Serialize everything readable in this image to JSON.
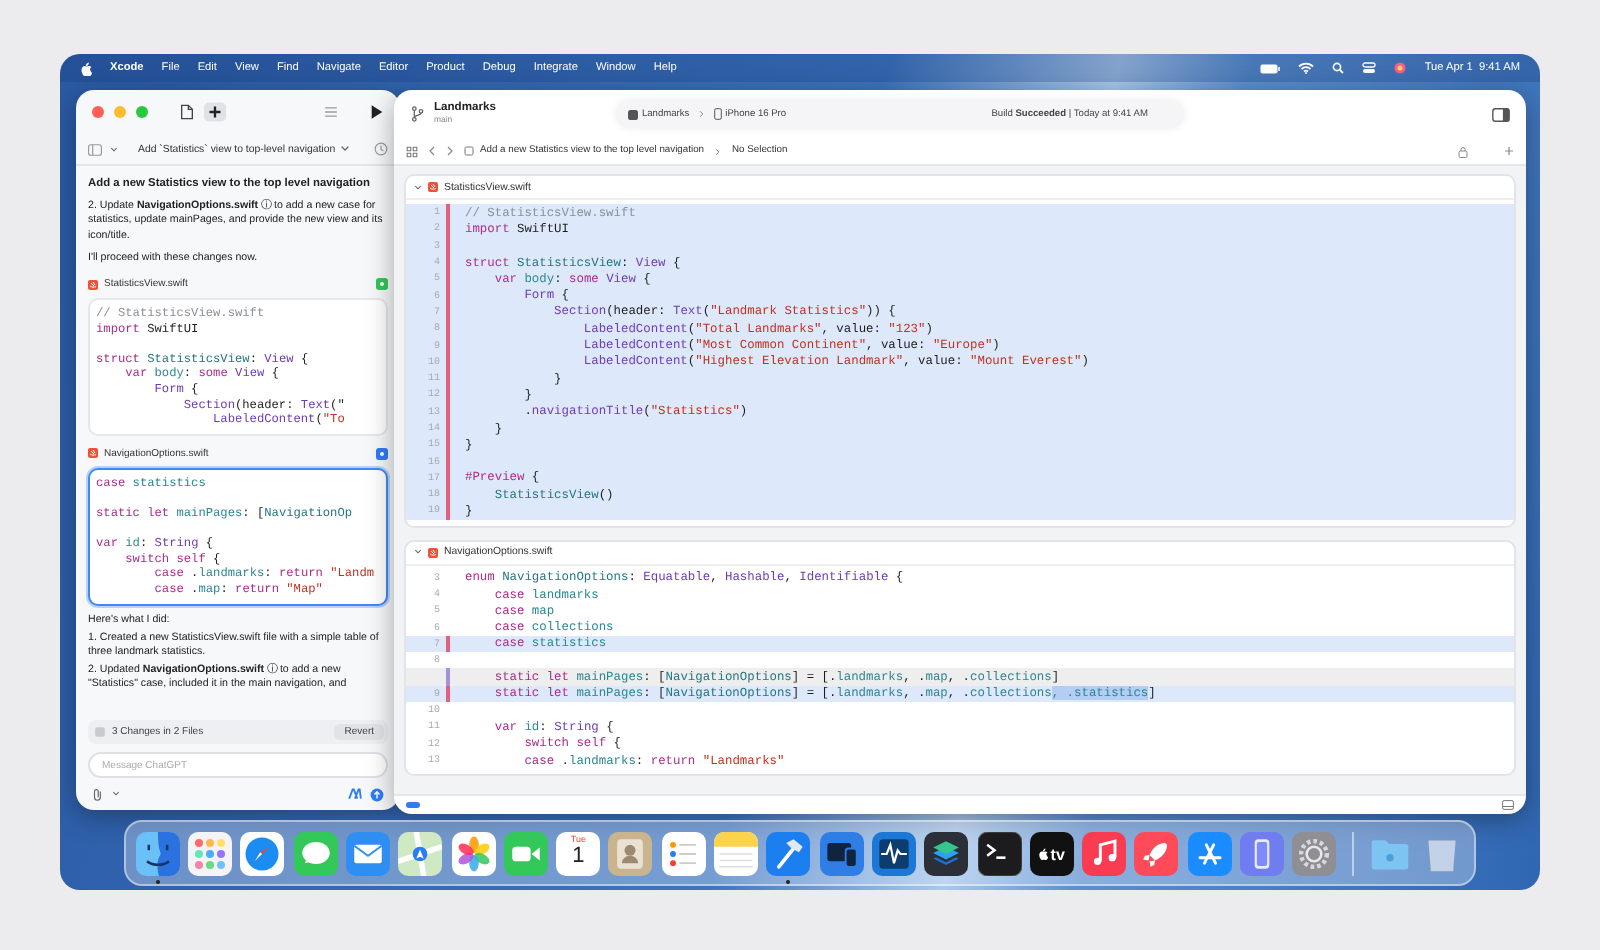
{
  "menu_bar": {
    "app": "Xcode",
    "items": [
      "File",
      "Edit",
      "View",
      "Find",
      "Navigate",
      "Editor",
      "Product",
      "Debug",
      "Integrate",
      "Window",
      "Help"
    ],
    "clock": "Tue Apr 1  9:41 AM"
  },
  "chat": {
    "title": "Add `Statistics` view to top-level navigation",
    "blocks": [
      {
        "kind": "heading",
        "text": "Add a new Statistics view to the top level navigation"
      },
      {
        "kind": "paragraph",
        "text": "2. Update **NavigationOptions.swift** ⓘ to add a new case for statistics, update mainPages, and provide the new view and its icon/title."
      },
      {
        "kind": "paragraph",
        "text": "I'll proceed with these changes now."
      },
      {
        "kind": "file",
        "name": "StatisticsView.swift",
        "color": "#34c759",
        "selected": false,
        "lines": [
          {
            "kind": "code",
            "tokens": [
              {
                "kind": "comment",
                "text": "// StatisticsView.swift"
              }
            ]
          },
          {
            "kind": "code",
            "tokens": [
              {
                "kind": "keyword",
                "text": "import"
              },
              {
                "kind": "plain",
                "text": " SwiftUI"
              }
            ]
          },
          {
            "kind": "blank"
          },
          {
            "kind": "code",
            "tokens": [
              {
                "kind": "keyword",
                "text": "struct "
              },
              {
                "kind": "type",
                "text": "StatisticsView"
              },
              {
                "kind": "plain",
                "text": ": "
              },
              {
                "kind": "class",
                "text": "View"
              },
              {
                "kind": "plain",
                "text": " {"
              }
            ]
          },
          {
            "kind": "code",
            "tokens": [
              {
                "kind": "keyword",
                "text": "    var "
              },
              {
                "kind": "member",
                "text": "body"
              },
              {
                "kind": "plain",
                "text": ": "
              },
              {
                "kind": "keyword",
                "text": "some "
              },
              {
                "kind": "class",
                "text": "View"
              },
              {
                "kind": "plain",
                "text": " {"
              }
            ]
          },
          {
            "kind": "code",
            "tokens": [
              {
                "kind": "class",
                "text": "        Form"
              },
              {
                "kind": "plain",
                "text": " {"
              }
            ]
          },
          {
            "kind": "code",
            "tokens": [
              {
                "kind": "class",
                "text": "            Section"
              },
              {
                "kind": "plain",
                "text": "(header: "
              },
              {
                "kind": "class",
                "text": "Text"
              },
              {
                "kind": "plain",
                "text": "(\""
              }
            ]
          },
          {
            "kind": "code",
            "tokens": [
              {
                "kind": "class",
                "text": "                LabeledContent"
              },
              {
                "kind": "plain",
                "text": "("
              },
              {
                "kind": "string",
                "text": "\"To"
              }
            ]
          }
        ]
      },
      {
        "kind": "file",
        "name": "NavigationOptions.swift",
        "color": "#2f7cf6",
        "selected": true,
        "lines": [
          {
            "kind": "code",
            "tokens": [
              {
                "kind": "keyword",
                "text": "case "
              },
              {
                "kind": "member",
                "text": "statistics"
              }
            ]
          },
          {
            "kind": "blank"
          },
          {
            "kind": "code",
            "tokens": [
              {
                "kind": "keyword",
                "text": "static let "
              },
              {
                "kind": "member",
                "text": "mainPages"
              },
              {
                "kind": "plain",
                "text": ": ["
              },
              {
                "kind": "type",
                "text": "NavigationOp"
              }
            ]
          },
          {
            "kind": "blank"
          },
          {
            "kind": "code",
            "tokens": [
              {
                "kind": "keyword",
                "text": "var "
              },
              {
                "kind": "member",
                "text": "id"
              },
              {
                "kind": "plain",
                "text": ": "
              },
              {
                "kind": "class",
                "text": "String"
              },
              {
                "kind": "plain",
                "text": " {"
              }
            ]
          },
          {
            "kind": "code",
            "tokens": [
              {
                "kind": "keyword",
                "text": "    switch self"
              },
              {
                "kind": "plain",
                "text": " {"
              }
            ]
          },
          {
            "kind": "code",
            "tokens": [
              {
                "kind": "keyword",
                "text": "        case"
              },
              {
                "kind": "plain",
                "text": " ."
              },
              {
                "kind": "member",
                "text": "landmarks"
              },
              {
                "kind": "plain",
                "text": ": "
              },
              {
                "kind": "keyword",
                "text": "return "
              },
              {
                "kind": "string",
                "text": "\"Landm"
              }
            ]
          },
          {
            "kind": "code",
            "tokens": [
              {
                "kind": "keyword",
                "text": "        case"
              },
              {
                "kind": "plain",
                "text": " ."
              },
              {
                "kind": "member",
                "text": "map"
              },
              {
                "kind": "plain",
                "text": ": "
              },
              {
                "kind": "keyword",
                "text": "return "
              },
              {
                "kind": "string",
                "text": "\"Map\""
              }
            ]
          }
        ]
      },
      {
        "kind": "paragraph",
        "text": "Here's what I did:"
      },
      {
        "kind": "list_item",
        "text": "1. Created a new StatisticsView.swift file with a simple table of three landmark statistics."
      },
      {
        "kind": "list_item",
        "text": "2. Updated **NavigationOptions.swift** ⓘ to add a new \"Statistics\" case, included it in the main navigation, and"
      }
    ],
    "changes": "3 Changes in 2 Files",
    "revert": "Revert",
    "input": {
      "placeholder": "Message ChatGPT"
    }
  },
  "xcode": {
    "project": "Landmarks",
    "branch": "main",
    "scheme": "Landmarks",
    "device": "iPhone 16 Pro",
    "status": "Build **Succeeded** | Today at 9:41 AM",
    "breadcrumb": "Add a new Statistics view to the top level navigation",
    "selection": "No Selection",
    "panes": [
      {
        "file": "StatisticsView.swift",
        "lines": [
          {
            "number": "1",
            "added": true,
            "removed": false,
            "kind": "code",
            "tokens": [
              {
                "kind": "comment",
                "text": "// StatisticsView.swift"
              }
            ]
          },
          {
            "number": "2",
            "added": true,
            "removed": false,
            "kind": "code",
            "tokens": [
              {
                "kind": "keyword",
                "text": "import"
              },
              {
                "kind": "plain",
                "text": " SwiftUI"
              }
            ]
          },
          {
            "number": "3",
            "added": true,
            "removed": false,
            "kind": "blank"
          },
          {
            "number": "4",
            "added": true,
            "removed": false,
            "kind": "code",
            "tokens": [
              {
                "kind": "keyword",
                "text": "struct "
              },
              {
                "kind": "type",
                "text": "StatisticsView"
              },
              {
                "kind": "plain",
                "text": ": "
              },
              {
                "kind": "class",
                "text": "View"
              },
              {
                "kind": "plain",
                "text": " {"
              }
            ]
          },
          {
            "number": "5",
            "added": true,
            "removed": false,
            "kind": "code",
            "tokens": [
              {
                "kind": "keyword",
                "text": "    var "
              },
              {
                "kind": "member",
                "text": "body"
              },
              {
                "kind": "plain",
                "text": ": "
              },
              {
                "kind": "keyword",
                "text": "some "
              },
              {
                "kind": "class",
                "text": "View"
              },
              {
                "kind": "plain",
                "text": " {"
              }
            ]
          },
          {
            "number": "6",
            "added": true,
            "removed": false,
            "kind": "code",
            "tokens": [
              {
                "kind": "class",
                "text": "        Form"
              },
              {
                "kind": "plain",
                "text": " {"
              }
            ]
          },
          {
            "number": "7",
            "added": true,
            "removed": false,
            "kind": "code",
            "tokens": [
              {
                "kind": "class",
                "text": "            Section"
              },
              {
                "kind": "plain",
                "text": "(header: "
              },
              {
                "kind": "class",
                "text": "Text"
              },
              {
                "kind": "plain",
                "text": "("
              },
              {
                "kind": "string",
                "text": "\"Landmark Statistics\""
              },
              {
                "kind": "plain",
                "text": ")) {"
              }
            ]
          },
          {
            "number": "8",
            "added": true,
            "removed": false,
            "kind": "code",
            "tokens": [
              {
                "kind": "class",
                "text": "                LabeledContent"
              },
              {
                "kind": "plain",
                "text": "("
              },
              {
                "kind": "string",
                "text": "\"Total Landmarks\""
              },
              {
                "kind": "plain",
                "text": ", value: "
              },
              {
                "kind": "string",
                "text": "\"123\""
              },
              {
                "kind": "plain",
                "text": ")"
              }
            ]
          },
          {
            "number": "9",
            "added": true,
            "removed": false,
            "kind": "code",
            "tokens": [
              {
                "kind": "class",
                "text": "                LabeledContent"
              },
              {
                "kind": "plain",
                "text": "("
              },
              {
                "kind": "string",
                "text": "\"Most Common Continent\""
              },
              {
                "kind": "plain",
                "text": ", value: "
              },
              {
                "kind": "string",
                "text": "\"Europe\""
              },
              {
                "kind": "plain",
                "text": ")"
              }
            ]
          },
          {
            "number": "10",
            "added": true,
            "removed": false,
            "kind": "code",
            "tokens": [
              {
                "kind": "class",
                "text": "                LabeledContent"
              },
              {
                "kind": "plain",
                "text": "("
              },
              {
                "kind": "string",
                "text": "\"Highest Elevation Landmark\""
              },
              {
                "kind": "plain",
                "text": ", value: "
              },
              {
                "kind": "string",
                "text": "\"Mount Everest\""
              },
              {
                "kind": "plain",
                "text": ")"
              }
            ]
          },
          {
            "number": "11",
            "added": true,
            "removed": false,
            "kind": "code",
            "tokens": [
              {
                "kind": "plain",
                "text": "            }"
              }
            ]
          },
          {
            "number": "12",
            "added": true,
            "removed": false,
            "kind": "code",
            "tokens": [
              {
                "kind": "plain",
                "text": "        }"
              }
            ]
          },
          {
            "number": "13",
            "added": true,
            "removed": false,
            "kind": "code",
            "tokens": [
              {
                "kind": "plain",
                "text": "        ."
              },
              {
                "kind": "class",
                "text": "navigationTitle"
              },
              {
                "kind": "plain",
                "text": "("
              },
              {
                "kind": "string",
                "text": "\"Statistics\""
              },
              {
                "kind": "plain",
                "text": ")"
              }
            ]
          },
          {
            "number": "14",
            "added": true,
            "removed": false,
            "kind": "code",
            "tokens": [
              {
                "kind": "plain",
                "text": "    }"
              }
            ]
          },
          {
            "number": "15",
            "added": true,
            "removed": false,
            "kind": "code",
            "tokens": [
              {
                "kind": "plain",
                "text": "}"
              }
            ]
          },
          {
            "number": "16",
            "added": true,
            "removed": false,
            "kind": "blank"
          },
          {
            "number": "17",
            "added": true,
            "removed": false,
            "kind": "code",
            "tokens": [
              {
                "kind": "keyword",
                "text": "#Preview"
              },
              {
                "kind": "plain",
                "text": " {"
              }
            ]
          },
          {
            "number": "18",
            "added": true,
            "removed": false,
            "kind": "code",
            "tokens": [
              {
                "kind": "type",
                "text": "    StatisticsView"
              },
              {
                "kind": "plain",
                "text": "()"
              }
            ]
          },
          {
            "number": "19",
            "added": true,
            "removed": false,
            "kind": "code",
            "tokens": [
              {
                "kind": "plain",
                "text": "}"
              }
            ]
          }
        ]
      },
      {
        "file": "NavigationOptions.swift",
        "lines": [
          {
            "number": "3",
            "added": false,
            "removed": false,
            "kind": "code",
            "tokens": [
              {
                "kind": "keyword",
                "text": "enum "
              },
              {
                "kind": "type",
                "text": "NavigationOptions"
              },
              {
                "kind": "plain",
                "text": ": "
              },
              {
                "kind": "class",
                "text": "Equatable"
              },
              {
                "kind": "plain",
                "text": ", "
              },
              {
                "kind": "class",
                "text": "Hashable"
              },
              {
                "kind": "plain",
                "text": ", "
              },
              {
                "kind": "class",
                "text": "Identifiable"
              },
              {
                "kind": "plain",
                "text": " {"
              }
            ]
          },
          {
            "number": "4",
            "added": false,
            "removed": false,
            "kind": "code",
            "tokens": [
              {
                "kind": "keyword",
                "text": "    case "
              },
              {
                "kind": "member",
                "text": "landmarks"
              }
            ]
          },
          {
            "number": "5",
            "added": false,
            "removed": false,
            "kind": "code",
            "tokens": [
              {
                "kind": "keyword",
                "text": "    case "
              },
              {
                "kind": "member",
                "text": "map"
              }
            ]
          },
          {
            "number": "6",
            "added": false,
            "removed": false,
            "kind": "code",
            "tokens": [
              {
                "kind": "keyword",
                "text": "    case "
              },
              {
                "kind": "member",
                "text": "collections"
              }
            ]
          },
          {
            "number": "7",
            "added": true,
            "removed": false,
            "kind": "code",
            "tokens": [
              {
                "kind": "keyword",
                "text": "    case "
              },
              {
                "kind": "member",
                "text": "statistics"
              }
            ]
          },
          {
            "number": "8",
            "added": false,
            "removed": false,
            "kind": "blank"
          },
          {
            "added": false,
            "removed": true,
            "kind": "code",
            "tokens": [
              {
                "kind": "keyword",
                "text": "    static let "
              },
              {
                "kind": "member",
                "text": "mainPages"
              },
              {
                "kind": "plain",
                "text": ": ["
              },
              {
                "kind": "type",
                "text": "NavigationOptions"
              },
              {
                "kind": "plain",
                "text": "] = [."
              },
              {
                "kind": "member",
                "text": "landmarks"
              },
              {
                "kind": "plain",
                "text": ", ."
              },
              {
                "kind": "member",
                "text": "map"
              },
              {
                "kind": "plain",
                "text": ", ."
              },
              {
                "kind": "member",
                "text": "collections"
              },
              {
                "kind": "plain",
                "text": "]"
              }
            ]
          },
          {
            "number": "9",
            "added": true,
            "removed": false,
            "kind": "code",
            "tokens": [
              {
                "kind": "keyword",
                "text": "    static let "
              },
              {
                "kind": "member",
                "text": "mainPages"
              },
              {
                "kind": "plain",
                "text": ": ["
              },
              {
                "kind": "type",
                "text": "NavigationOptions"
              },
              {
                "kind": "plain",
                "text": "] = [."
              },
              {
                "kind": "member",
                "text": "landmarks"
              },
              {
                "kind": "plain",
                "text": ", ."
              },
              {
                "kind": "member",
                "text": "map"
              },
              {
                "kind": "plain",
                "text": ", ."
              },
              {
                "kind": "member",
                "text": "collections"
              },
              {
                "kind": "selection",
                "text": ", .statistics"
              },
              {
                "kind": "plain",
                "text": "]"
              }
            ]
          },
          {
            "number": "10",
            "added": false,
            "removed": false,
            "kind": "blank"
          },
          {
            "number": "11",
            "added": false,
            "removed": false,
            "kind": "code",
            "tokens": [
              {
                "kind": "keyword",
                "text": "    var "
              },
              {
                "kind": "member",
                "text": "id"
              },
              {
                "kind": "plain",
                "text": ": "
              },
              {
                "kind": "class",
                "text": "String"
              },
              {
                "kind": "plain",
                "text": " {"
              }
            ]
          },
          {
            "number": "12",
            "added": false,
            "removed": false,
            "kind": "code",
            "tokens": [
              {
                "kind": "keyword",
                "text": "        switch self"
              },
              {
                "kind": "plain",
                "text": " {"
              }
            ]
          },
          {
            "number": "13",
            "added": false,
            "removed": false,
            "kind": "code",
            "tokens": [
              {
                "kind": "keyword",
                "text": "        case"
              },
              {
                "kind": "plain",
                "text": " ."
              },
              {
                "kind": "member",
                "text": "landmarks"
              },
              {
                "kind": "plain",
                "text": ": "
              },
              {
                "kind": "keyword",
                "text": "return "
              },
              {
                "kind": "string",
                "text": "\"Landmarks\""
              }
            ]
          }
        ]
      }
    ]
  },
  "dock": {
    "apps": [
      {
        "kind": "finder",
        "running": true
      },
      {
        "kind": "launchpad",
        "running": false
      },
      {
        "kind": "safari",
        "running": false
      },
      {
        "kind": "messages",
        "running": false
      },
      {
        "kind": "mail",
        "running": false
      },
      {
        "kind": "maps",
        "running": false
      },
      {
        "kind": "photos",
        "running": false
      },
      {
        "kind": "facetime",
        "running": false
      },
      {
        "kind": "calendar",
        "running": false,
        "weekday": "Tue",
        "day": "1"
      },
      {
        "kind": "contacts",
        "running": false
      },
      {
        "kind": "reminders",
        "running": false
      },
      {
        "kind": "notes",
        "running": false
      },
      {
        "kind": "xcode",
        "running": true
      },
      {
        "kind": "simulator",
        "running": false
      },
      {
        "kind": "instruments",
        "running": false
      },
      {
        "kind": "layers",
        "running": false
      },
      {
        "kind": "terminal",
        "running": false
      },
      {
        "kind": "tv",
        "running": false,
        "label": "tv"
      },
      {
        "kind": "music",
        "running": false
      },
      {
        "kind": "rocket",
        "running": false
      },
      {
        "kind": "app_store",
        "running": false
      },
      {
        "kind": "mirroring",
        "running": false
      },
      {
        "kind": "settings",
        "running": false
      }
    ],
    "others": [
      {
        "kind": "folder"
      },
      {
        "kind": "trash"
      }
    ]
  }
}
